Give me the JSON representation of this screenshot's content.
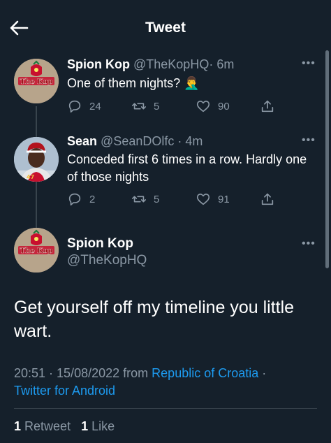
{
  "header": {
    "title": "Tweet"
  },
  "thread": [
    {
      "avatar_text": "The Kop",
      "name": "Spion Kop",
      "handle": "@TheKopHQ",
      "time": "· 6m",
      "text": "One of them nights? 🤦‍♂️",
      "replies": "24",
      "retweets": "5",
      "likes": "90"
    },
    {
      "name": "Sean",
      "handle": "@SeanDOlfc",
      "time": "· 4m",
      "text": "Conceded first 6 times in a row. Hardly one of those nights",
      "replies": "2",
      "retweets": "5",
      "likes": "91"
    }
  ],
  "main": {
    "avatar_text": "The Kop",
    "name": "Spion Kop",
    "handle": "@TheKopHQ",
    "text": "Get yourself off my timeline you little wart.",
    "timestamp": "20:51 · 15/08/2022",
    "from_label": "from",
    "location": "Republic of Croatia",
    "separator": "·",
    "source": "Twitter for Android",
    "retweet_count": "1",
    "retweet_label": "Retweet",
    "like_count": "1",
    "like_label": "Like"
  },
  "colors": {
    "background": "#15202b",
    "accent": "#1d9bf0",
    "muted": "#8b98a5",
    "divider": "#38444d"
  },
  "icons": [
    "back-arrow-icon",
    "more-icon",
    "reply-icon",
    "retweet-icon",
    "like-icon",
    "share-icon"
  ]
}
